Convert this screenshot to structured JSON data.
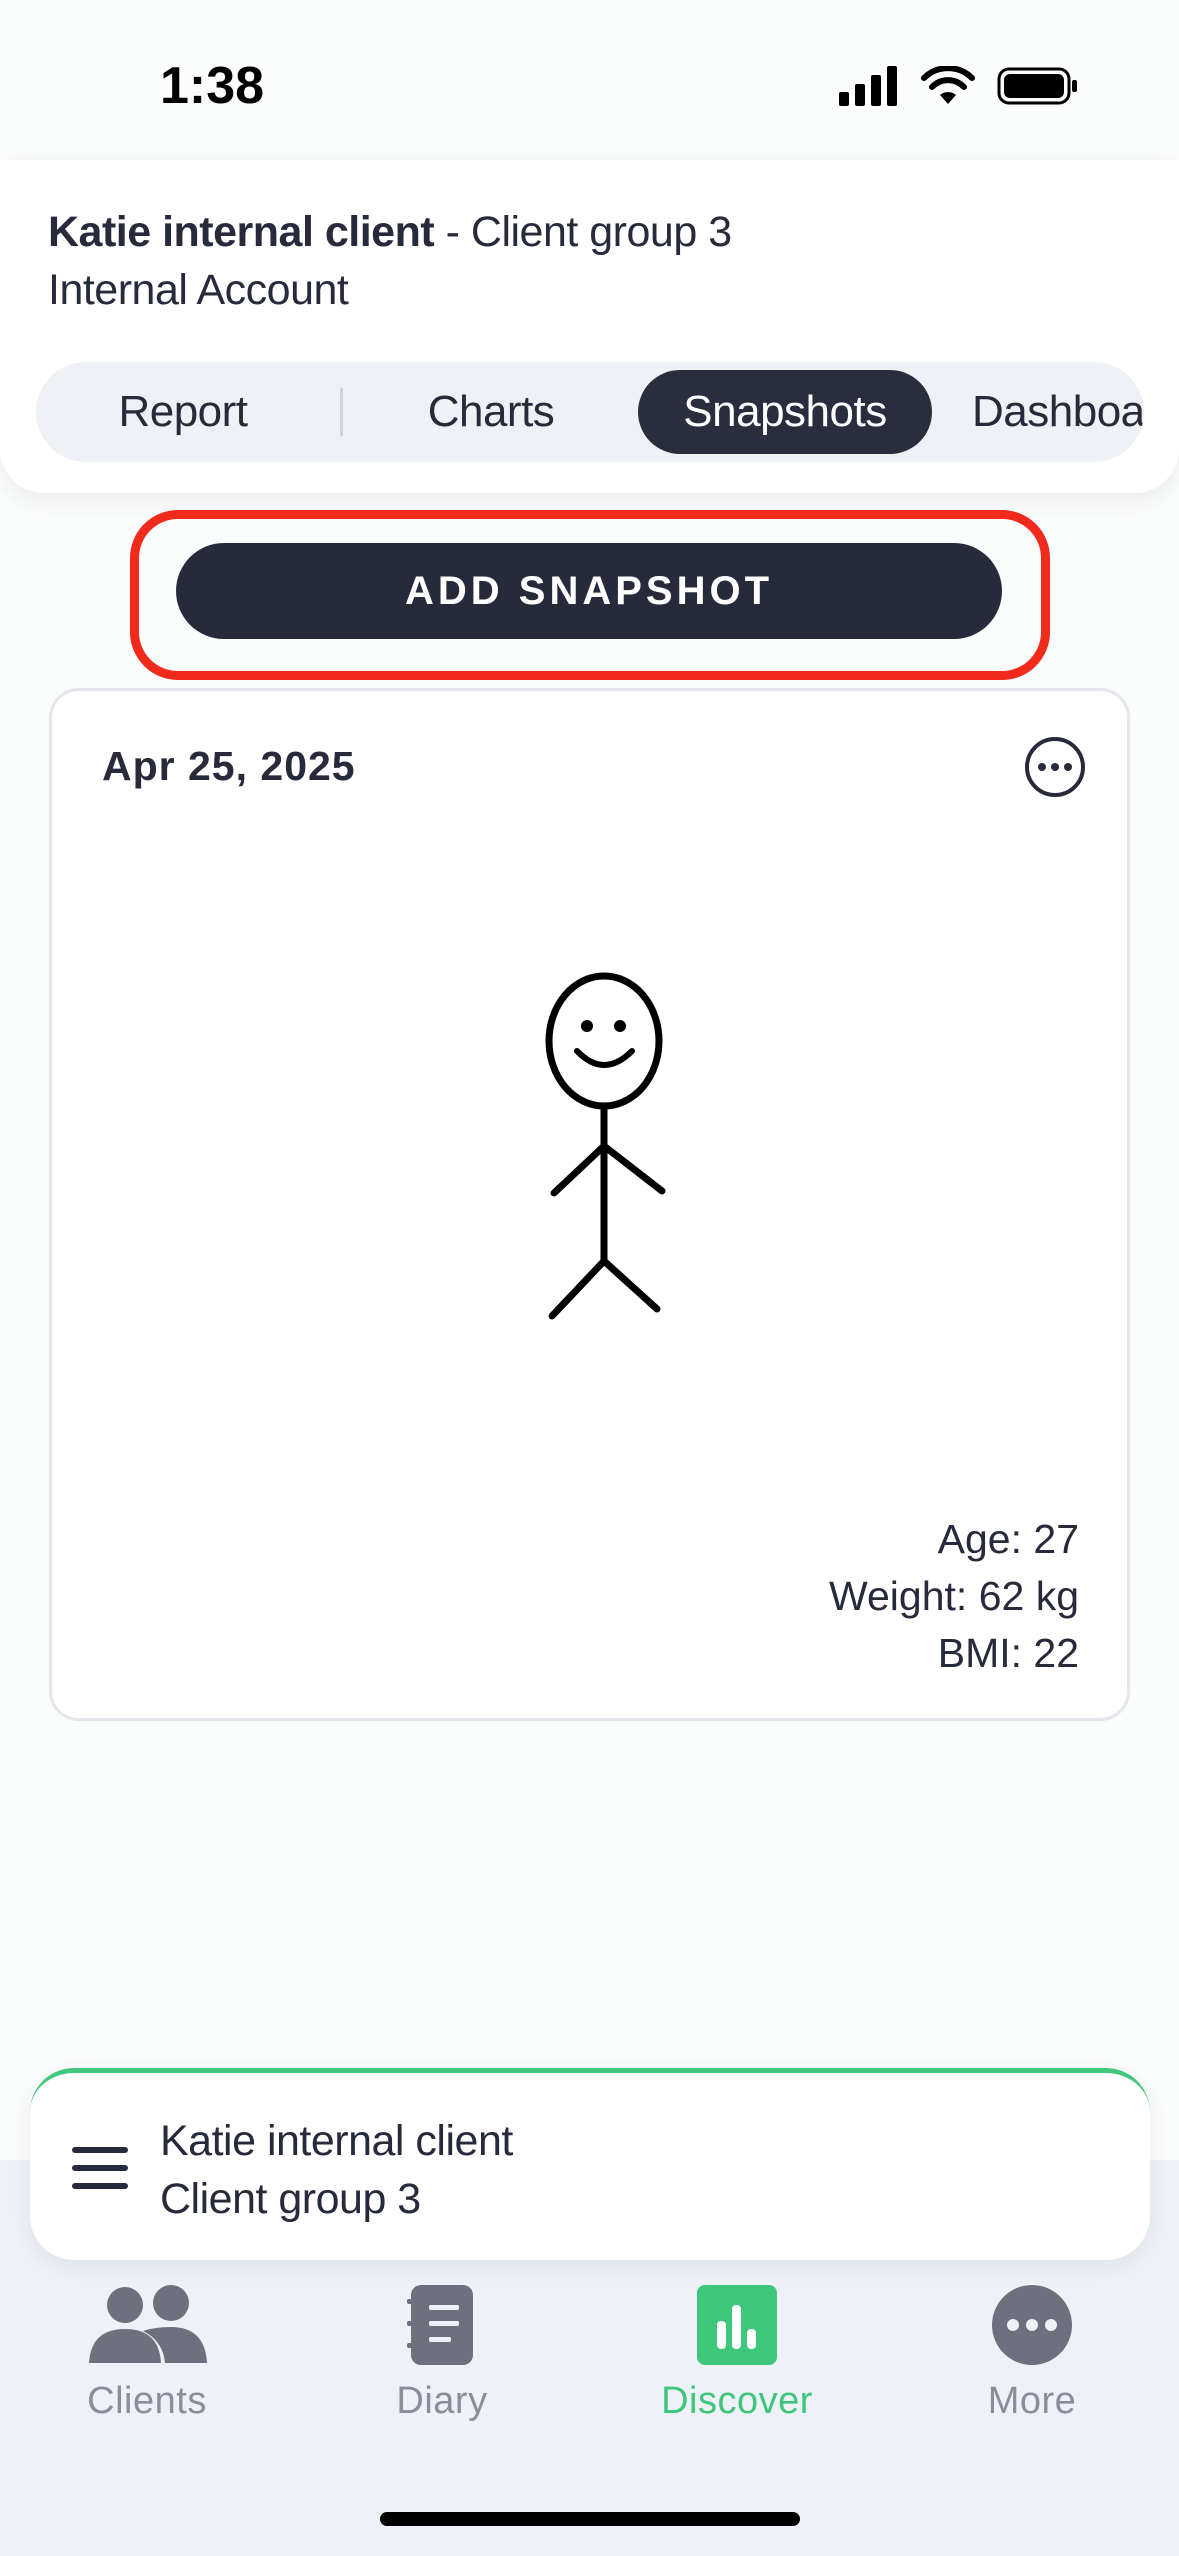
{
  "status_bar": {
    "time": "1:38"
  },
  "header": {
    "client_name": "Katie internal client",
    "client_group_suffix": " - Client group 3",
    "account": "Internal Account",
    "tabs": [
      {
        "label": "Report"
      },
      {
        "label": "Charts"
      },
      {
        "label": "Snapshots",
        "active": true
      },
      {
        "label": "Dashboa"
      }
    ]
  },
  "actions": {
    "add_snapshot_label": "ADD SNAPSHOT"
  },
  "snapshot": {
    "date": "Apr 25, 2025",
    "more_icon": "more-horizontal-icon",
    "age": "Age: 27",
    "weight": "Weight: 62 kg",
    "bmi": "BMI: 22"
  },
  "client_bar": {
    "name": "Katie internal client",
    "group": "Client group 3"
  },
  "tabbar": {
    "items": [
      {
        "label": "Clients",
        "icon": "clients-icon"
      },
      {
        "label": "Diary",
        "icon": "diary-icon"
      },
      {
        "label": "Discover",
        "icon": "discover-icon",
        "active": true
      },
      {
        "label": "More",
        "icon": "more-icon"
      }
    ]
  },
  "colors": {
    "accent_green": "#3ec77a",
    "dark": "#262a3a",
    "highlight_red": "#f22a1c"
  }
}
